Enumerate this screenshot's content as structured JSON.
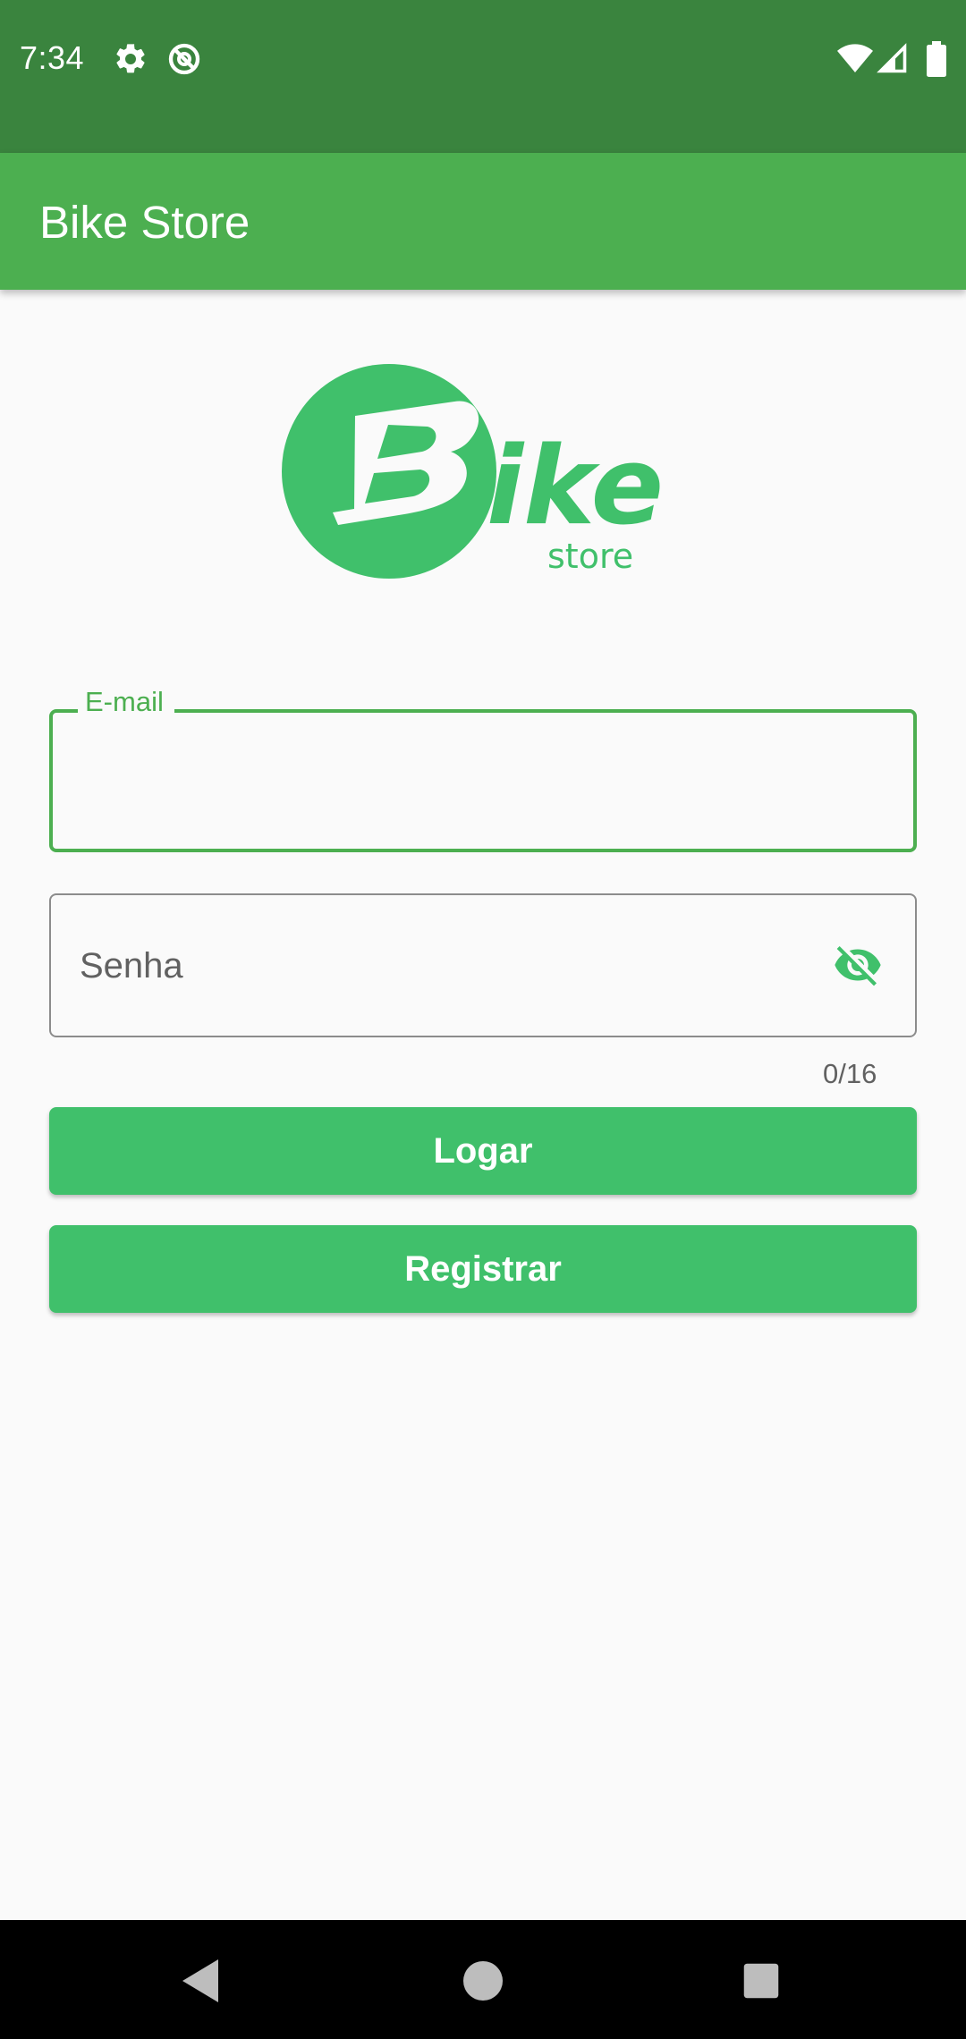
{
  "status_bar": {
    "time": "7:34",
    "icons": [
      "gear-icon",
      "dnd-icon",
      "wifi-icon",
      "signal-icon",
      "battery-icon"
    ]
  },
  "app_bar": {
    "title": "Bike Store"
  },
  "logo": {
    "brand": "Bike",
    "sub": "store",
    "color": "#40c06b"
  },
  "form": {
    "email": {
      "label": "E-mail",
      "value": ""
    },
    "password": {
      "placeholder": "Senha",
      "value": "",
      "counter": "0/16",
      "visibility_icon": "eye-off-icon"
    }
  },
  "buttons": {
    "login_label": "Logar",
    "register_label": "Registrar"
  },
  "colors": {
    "status_bar": "#3a843e",
    "app_bar": "#4caf50",
    "accent": "#40c06b",
    "background": "#fafafa"
  },
  "nav_bar": {
    "icons": [
      "back-icon",
      "home-icon",
      "recents-icon"
    ]
  }
}
